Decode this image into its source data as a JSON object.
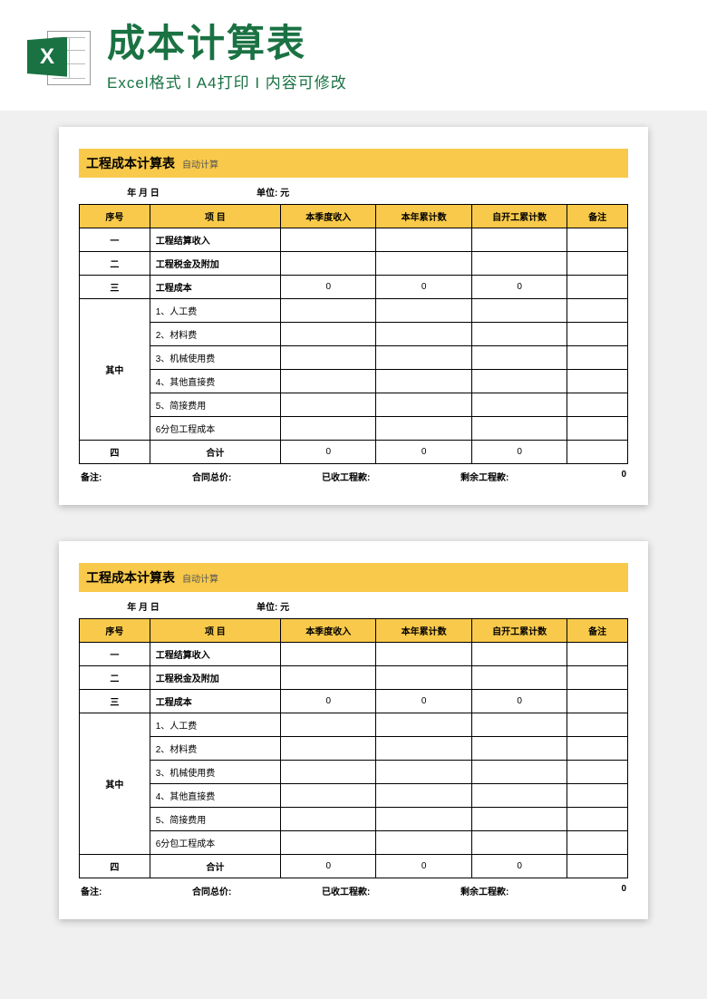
{
  "header": {
    "icon_letter": "X",
    "title": "成本计算表",
    "subtitle": "Excel格式 I A4打印 I 内容可修改"
  },
  "sheet": {
    "banner_title": "工程成本计算表",
    "banner_sub": "自动计算",
    "date_label": "年  月  日",
    "unit_label": "单位: 元",
    "columns": {
      "seq": "序号",
      "item": "项 目",
      "c1": "本季度收入",
      "c2": "本年累计数",
      "c3": "自开工累计数",
      "remark": "备注"
    },
    "rows": [
      {
        "seq": "一",
        "item": "工程结算收入",
        "c1": "",
        "c2": "",
        "c3": ""
      },
      {
        "seq": "二",
        "item": "工程税金及附加",
        "c1": "",
        "c2": "",
        "c3": ""
      },
      {
        "seq": "三",
        "item": "工程成本",
        "c1": "0",
        "c2": "0",
        "c3": "0"
      }
    ],
    "group_label": "其中",
    "sub_rows": [
      {
        "item": "1、人工费"
      },
      {
        "item": "2、材料费"
      },
      {
        "item": "3、机械使用费"
      },
      {
        "item": "4、其他直接费"
      },
      {
        "item": "5、简接费用"
      },
      {
        "item": "6分包工程成本"
      }
    ],
    "total_row": {
      "seq": "四",
      "item": "合计",
      "c1": "0",
      "c2": "0",
      "c3": "0"
    },
    "footer": {
      "remark_label": "备注:",
      "contract_label": "合同总价:",
      "received_label": "已收工程款:",
      "remaining_label": "剩余工程款:",
      "remaining_value": "0"
    }
  }
}
